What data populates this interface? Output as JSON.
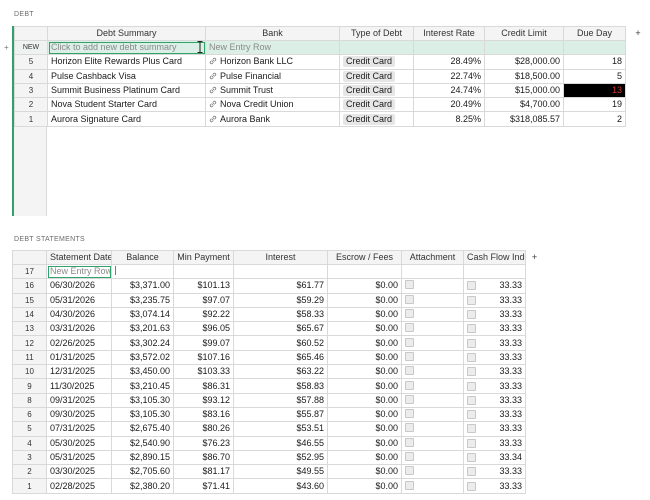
{
  "debt": {
    "section_title": "DEBT",
    "add_col": "+",
    "headers": {
      "summary": "Debt Summary",
      "bank": "Bank",
      "type": "Type of Debt",
      "rate": "Interest Rate",
      "limit": "Credit Limit",
      "due": "Due Day"
    },
    "new_row": {
      "label": "NEW",
      "summary_placeholder": "Click to add new debt summary",
      "bank_placeholder": "New Entry Row"
    },
    "rows": [
      {
        "n": "5",
        "summary": "Horizon Elite Rewards Plus Card",
        "bank": "Horizon Bank LLC",
        "type": "Credit Card",
        "rate": "28.49%",
        "limit": "$28,000.00",
        "due": "18"
      },
      {
        "n": "4",
        "summary": "Pulse Cashback Visa",
        "bank": "Pulse Financial",
        "type": "Credit Card",
        "rate": "22.74%",
        "limit": "$18,500.00",
        "due": "5"
      },
      {
        "n": "3",
        "summary": "Summit Business Platinum Card",
        "bank": "Summit Trust",
        "type": "Credit Card",
        "rate": "24.74%",
        "limit": "$15,000.00",
        "due": "13"
      },
      {
        "n": "2",
        "summary": "Nova Student Starter Card",
        "bank": "Nova Credit Union",
        "type": "Credit Card",
        "rate": "20.49%",
        "limit": "$4,700.00",
        "due": "19"
      },
      {
        "n": "1",
        "summary": "Aurora Signature Card",
        "bank": "Aurora Bank",
        "type": "Credit Card",
        "rate": "8.25%",
        "limit": "$318,085.57",
        "due": "2"
      }
    ],
    "highlight_color": "#000000"
  },
  "statements": {
    "section_title": "DEBT STATEMENTS",
    "add_col": "+",
    "headers": {
      "date": "Statement Date",
      "balance": "Balance",
      "min": "Min Payment",
      "interest": "Interest",
      "escrow": "Escrow / Fees",
      "attach": "Attachment",
      "cfi": "Cash Flow Index"
    },
    "new_row": {
      "n": "17",
      "placeholder": "New Entry Row"
    },
    "rows": [
      {
        "n": "16",
        "date": "06/30/2026",
        "balance": "$3,371.00",
        "min": "$101.13",
        "interest": "$61.77",
        "escrow": "$0.00",
        "cfi": "33.33"
      },
      {
        "n": "15",
        "date": "05/31/2026",
        "balance": "$3,235.75",
        "min": "$97.07",
        "interest": "$59.29",
        "escrow": "$0.00",
        "cfi": "33.33"
      },
      {
        "n": "14",
        "date": "04/30/2026",
        "balance": "$3,074.14",
        "min": "$92.22",
        "interest": "$58.33",
        "escrow": "$0.00",
        "cfi": "33.33"
      },
      {
        "n": "13",
        "date": "03/31/2026",
        "balance": "$3,201.63",
        "min": "$96.05",
        "interest": "$65.67",
        "escrow": "$0.00",
        "cfi": "33.33"
      },
      {
        "n": "12",
        "date": "02/26/2025",
        "balance": "$3,302.24",
        "min": "$99.07",
        "interest": "$60.52",
        "escrow": "$0.00",
        "cfi": "33.33"
      },
      {
        "n": "11",
        "date": "01/31/2025",
        "balance": "$3,572.02",
        "min": "$107.16",
        "interest": "$65.46",
        "escrow": "$0.00",
        "cfi": "33.33"
      },
      {
        "n": "10",
        "date": "12/31/2025",
        "balance": "$3,450.00",
        "min": "$103.33",
        "interest": "$63.22",
        "escrow": "$0.00",
        "cfi": "33.33"
      },
      {
        "n": "9",
        "date": "11/30/2025",
        "balance": "$3,210.45",
        "min": "$86.31",
        "interest": "$58.83",
        "escrow": "$0.00",
        "cfi": "33.33"
      },
      {
        "n": "8",
        "date": "09/31/2025",
        "balance": "$3,105.30",
        "min": "$93.12",
        "interest": "$57.88",
        "escrow": "$0.00",
        "cfi": "33.33"
      },
      {
        "n": "6",
        "date": "09/30/2025",
        "balance": "$3,105.30",
        "min": "$83.16",
        "interest": "$55.87",
        "escrow": "$0.00",
        "cfi": "33.33"
      },
      {
        "n": "5",
        "date": "07/31/2025",
        "balance": "$2,675.40",
        "min": "$80.26",
        "interest": "$53.51",
        "escrow": "$0.00",
        "cfi": "33.33"
      },
      {
        "n": "4",
        "date": "05/30/2025",
        "balance": "$2,540.90",
        "min": "$76.23",
        "interest": "$46.55",
        "escrow": "$0.00",
        "cfi": "33.33"
      },
      {
        "n": "3",
        "date": "05/31/2025",
        "balance": "$2,890.15",
        "min": "$86.70",
        "interest": "$52.95",
        "escrow": "$0.00",
        "cfi": "33.34"
      },
      {
        "n": "2",
        "date": "03/30/2025",
        "balance": "$2,705.60",
        "min": "$81.17",
        "interest": "$49.55",
        "escrow": "$0.00",
        "cfi": "33.33"
      },
      {
        "n": "1",
        "date": "02/28/2025",
        "balance": "$2,380.20",
        "min": "$71.41",
        "interest": "$43.60",
        "escrow": "$0.00",
        "cfi": "33.33"
      }
    ]
  },
  "colors": {
    "accent": "#2fa36b",
    "new_row": "#dcefe6",
    "due_highlight_text": "#d23434"
  }
}
